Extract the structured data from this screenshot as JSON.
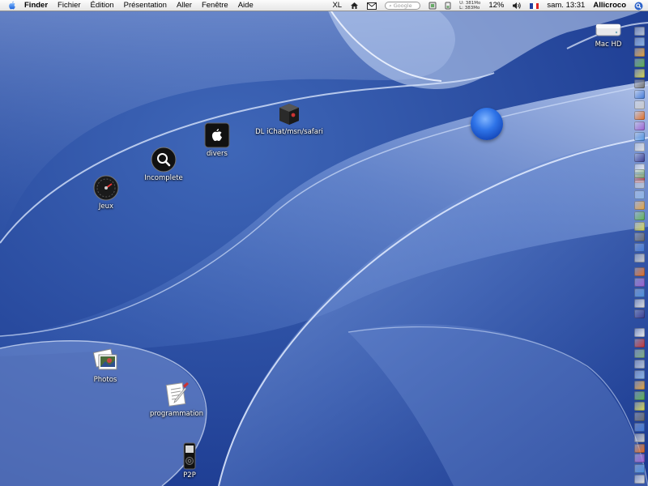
{
  "menubar": {
    "app_name": "Finder",
    "menus": [
      "Fichier",
      "Édition",
      "Présentation",
      "Aller",
      "Fenêtre",
      "Aide"
    ],
    "extras": {
      "xl_label": "XL",
      "google_placeholder": "Google",
      "net_up": "U: 381Mo",
      "net_down": "L: 383Mo",
      "battery": "12%",
      "clock": "sam. 13:31",
      "user": "Allicroco"
    }
  },
  "desktop": {
    "icons": [
      {
        "label": "Mac HD",
        "icon": "hard-drive-icon"
      },
      {
        "label": "DL iChat/msn/safari",
        "icon": "dark-box-icon"
      },
      {
        "label": "divers",
        "icon": "apple-square-icon"
      },
      {
        "label": "Incomplete",
        "icon": "magnifier-icon"
      },
      {
        "label": "Jeux",
        "icon": "speedometer-icon"
      },
      {
        "label": "Photos",
        "icon": "photos-icon"
      },
      {
        "label": "programmation",
        "icon": "document-pen-icon"
      },
      {
        "label": "P2P",
        "icon": "ipod-icon"
      }
    ]
  },
  "colors": {
    "wallpaper_dark": "#1c3b8c",
    "wallpaper_light": "#c8d6f4",
    "menubar": "#efefef"
  }
}
